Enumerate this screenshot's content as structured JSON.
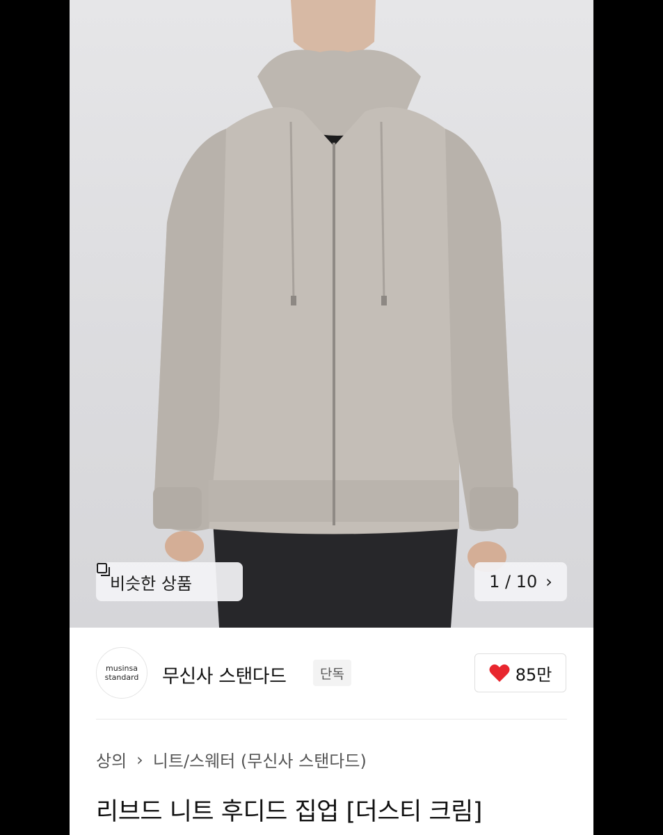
{
  "gallery": {
    "similar_label": "비슷한 상품",
    "current": "1",
    "total": "10",
    "counter_text": "1 / 10"
  },
  "brand": {
    "logo_line1": "musinsa",
    "logo_line2": "standard",
    "name": "무신사 스탠다드",
    "exclusive_badge": "단독",
    "likes": "85만",
    "heart_color": "#e8262e"
  },
  "breadcrumb": {
    "category": "상의",
    "subcategory": "니트/스웨터 (무신사 스탠다드)"
  },
  "product": {
    "title": "리브드 니트 후디드 집업 [더스티 크림]"
  },
  "icons": {
    "similar": "copy-squares-icon",
    "next": "chevron-right-icon",
    "breadcrumb_sep": "chevron-right-icon",
    "like": "heart-icon"
  }
}
